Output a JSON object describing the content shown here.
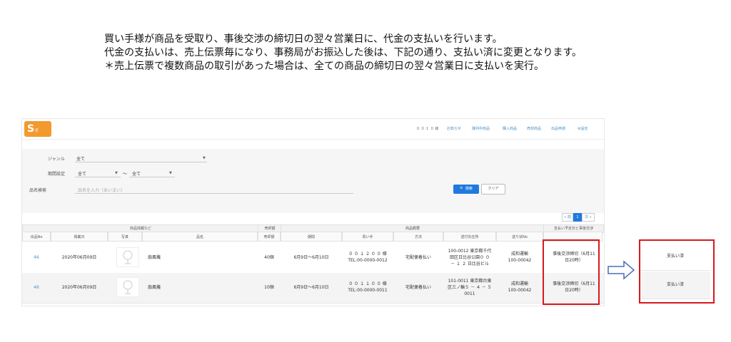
{
  "intro": {
    "line1": "買い手様が商品を受取り、事後交渉の締切日の翌々営業日に、代金の支払いを行います。",
    "line2": "代金の支払いは、売上伝票毎になり、事務局がお振込した後は、下記の通り、支払い済に変更となります。",
    "line3": "＊売上伝票で複数商品の取引があった場合は、全ての商品の締切日の翌々営業日に支払いを実行。"
  },
  "header": {
    "logo": "S",
    "logo_sub": "ポ",
    "user": "０ ０ １ ０ 様",
    "nav": [
      "お知らせ",
      "陳列中商品",
      "購入商品",
      "売却商品",
      "出品申請",
      "⚙設定"
    ]
  },
  "filter": {
    "genre_label": "ジャンル",
    "genre_value": "全て",
    "period_label": "期間設定",
    "period_from": "全て",
    "period_sep": "〜",
    "period_to": "全て",
    "name_label": "品名検索",
    "name_placeholder": "品名を入力（あいまい）",
    "search_button": "🔍 検索",
    "clear_button": "クリア"
  },
  "pager": {
    "prev": "« 前",
    "current": "1",
    "next": "次 »"
  },
  "table": {
    "group_headers": {
      "product": "商品情報など",
      "seller": "売却額",
      "sale": "商品概要",
      "payment": "支払い予定日と事後交渉"
    },
    "columns": [
      "出品No",
      "掲載日",
      "写真",
      "品名",
      "売却額",
      "期間",
      "買い手",
      "方法",
      "送付先住所",
      "送り状No"
    ],
    "rows": [
      {
        "no": "46",
        "date": "2020年06月09日",
        "name": "扇風機",
        "price": "40個",
        "period": "6月9日〜6月10日",
        "buyer1": "０ ０ １ ２ ０ ０ 様",
        "buyer2": "TEL:00-0000-0012",
        "method": "宅配便着払い",
        "addr1": "100-0012 東京都千代",
        "addr2": "田区日比谷公園０ ０",
        "addr3": "－ １ ２ 日比谷ビル",
        "ship1": "成和運輸",
        "ship2": "100-00042",
        "status1": "事後交渉締切（6月11",
        "status2": "日20時）"
      },
      {
        "no": "46",
        "date": "2020年06月09日",
        "name": "扇風機",
        "price": "10個",
        "period": "6月9日〜6月10日",
        "buyer1": "０ ０ １ １ ０ ０ 様",
        "buyer2": "TEL:00-0000-0011",
        "method": "宅配便着払い",
        "addr1": "101-0011 東京都台東",
        "addr2": "区三ノ輪５ － ４ － ５",
        "addr3": "0011",
        "ship1": "成和運輸",
        "ship2": "100-00042",
        "status1": "事後交渉締切（6月11",
        "status2": "日20時）"
      }
    ]
  },
  "after": {
    "row1": "支払い済",
    "row2": "支払い済"
  },
  "colors": {
    "accent": "#1f7ae0",
    "link": "#4a90c6",
    "highlight": "#d8191e",
    "logo": "#f29a2e"
  },
  "icons": {
    "arrow": "right-arrow-icon",
    "thumb": "fan-icon"
  }
}
